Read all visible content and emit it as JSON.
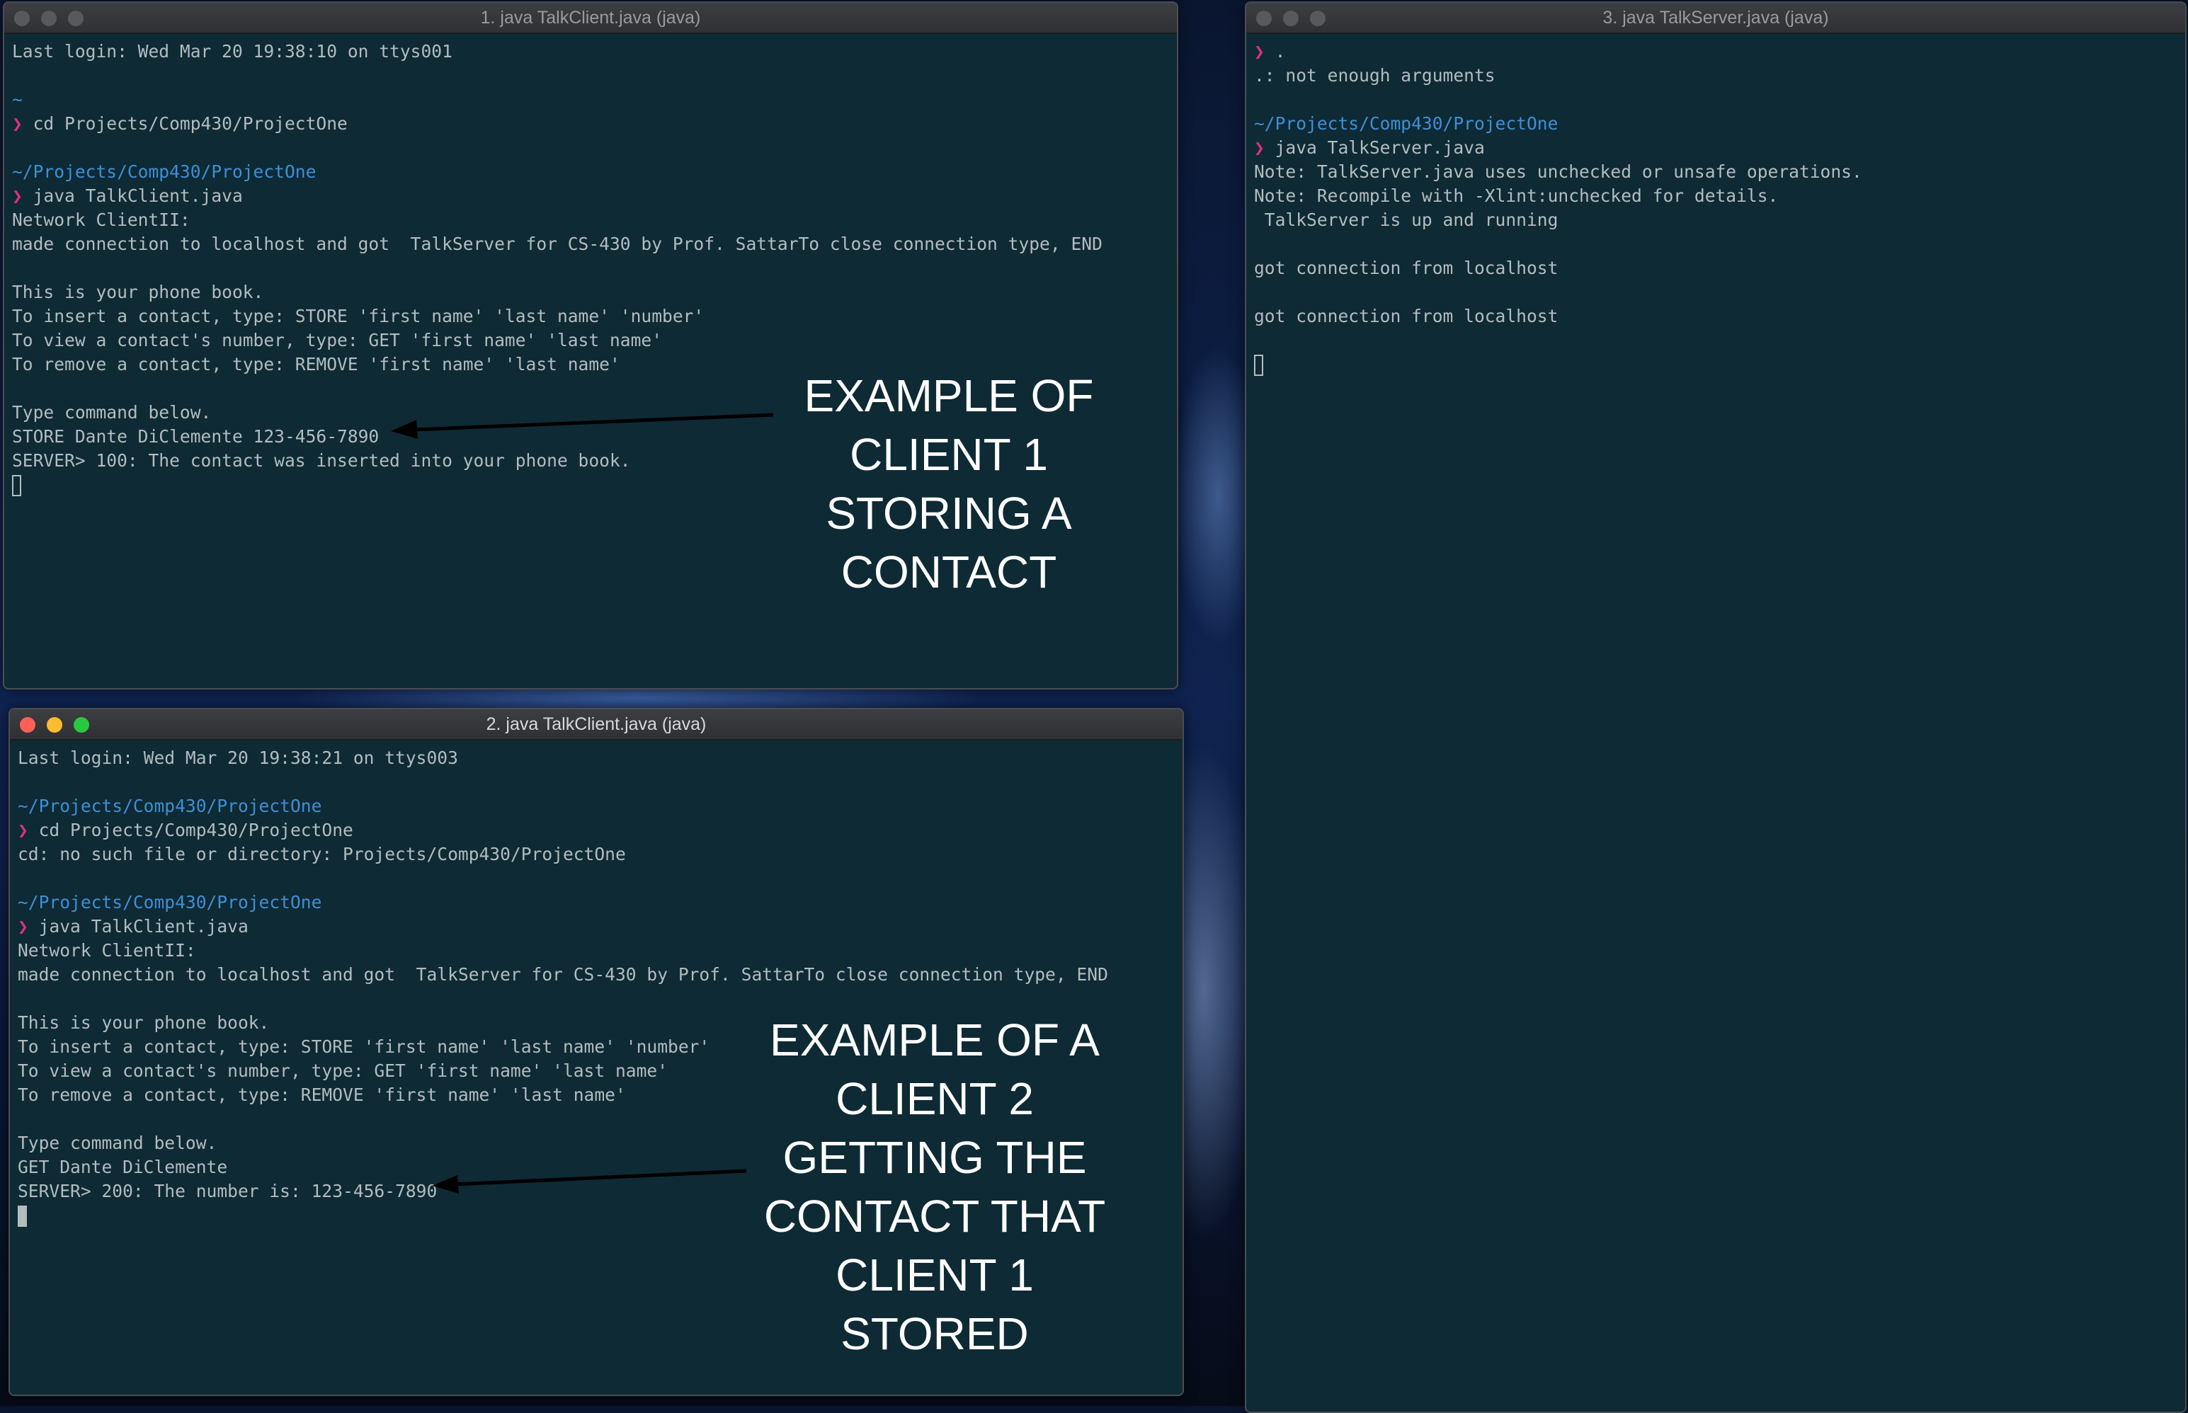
{
  "windows": [
    {
      "title": "1. java TalkClient.java (java)",
      "lines": [
        "Last login: Wed Mar 20 19:38:10 on ttys001",
        "",
        "~",
        "❯ cd Projects/Comp430/ProjectOne",
        "",
        "~/Projects/Comp430/ProjectOne",
        "❯ java TalkClient.java",
        "Network ClientII:",
        "made connection to localhost and got  TalkServer for CS-430 by Prof. SattarTo close connection type, END",
        "",
        "This is your phone book.",
        "To insert a contact, type: STORE 'first name' 'last name' 'number'",
        "To view a contact's number, type: GET 'first name' 'last name'",
        "To remove a contact, type: REMOVE 'first name' 'last name'",
        "",
        "Type command below.",
        "STORE Dante DiClemente 123-456-7890",
        "SERVER> 100: The contact was inserted into your phone book."
      ],
      "annotation": [
        "EXAMPLE OF",
        "CLIENT 1",
        "STORING A",
        "CONTACT"
      ]
    },
    {
      "title": "2. java TalkClient.java (java)",
      "lines": [
        "Last login: Wed Mar 20 19:38:21 on ttys003",
        "",
        "~/Projects/Comp430/ProjectOne",
        "❯ cd Projects/Comp430/ProjectOne",
        "cd: no such file or directory: Projects/Comp430/ProjectOne",
        "",
        "~/Projects/Comp430/ProjectOne",
        "❯ java TalkClient.java",
        "Network ClientII:",
        "made connection to localhost and got  TalkServer for CS-430 by Prof. SattarTo close connection type, END",
        "",
        "This is your phone book.",
        "To insert a contact, type: STORE 'first name' 'last name' 'number'",
        "To view a contact's number, type: GET 'first name' 'last name'",
        "To remove a contact, type: REMOVE 'first name' 'last name'",
        "",
        "Type command below.",
        "GET Dante DiClemente",
        "SERVER> 200: The number is: 123-456-7890"
      ],
      "annotation": [
        "EXAMPLE OF A",
        "CLIENT 2",
        "GETTING THE",
        "CONTACT THAT",
        "CLIENT 1",
        "STORED"
      ]
    },
    {
      "title": "3. java TalkServer.java (java)",
      "lines": [
        "❯ .",
        ".: not enough arguments",
        "",
        "~/Projects/Comp430/ProjectOne",
        "❯ java TalkServer.java",
        "Note: TalkServer.java uses unchecked or unsafe operations.",
        "Note: Recompile with -Xlint:unchecked for details.",
        " TalkServer is up and running",
        "",
        "got connection from localhost",
        "",
        "got connection from localhost"
      ]
    }
  ],
  "colors": {
    "terminal_bg": "#0e2a35",
    "text": "#b3bcbf",
    "path": "#3f8fd4",
    "prompt": "#e0307a",
    "annotation": "#ffffff",
    "arrow": "#000000"
  }
}
